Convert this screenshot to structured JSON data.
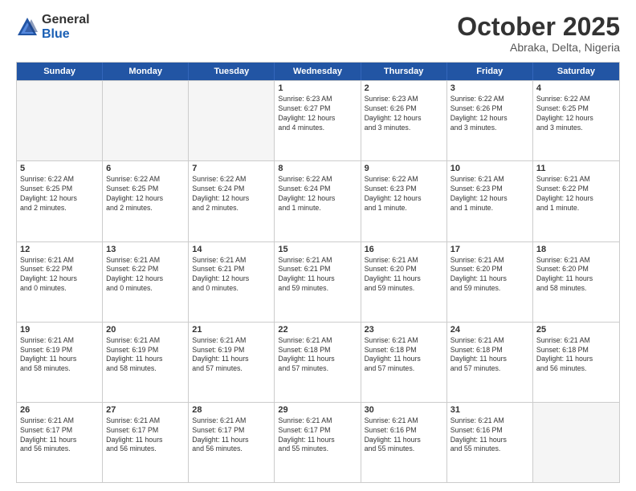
{
  "logo": {
    "general": "General",
    "blue": "Blue"
  },
  "title": "October 2025",
  "location": "Abraka, Delta, Nigeria",
  "days_of_week": [
    "Sunday",
    "Monday",
    "Tuesday",
    "Wednesday",
    "Thursday",
    "Friday",
    "Saturday"
  ],
  "weeks": [
    [
      {
        "day": "",
        "info": ""
      },
      {
        "day": "",
        "info": ""
      },
      {
        "day": "",
        "info": ""
      },
      {
        "day": "1",
        "info": "Sunrise: 6:23 AM\nSunset: 6:27 PM\nDaylight: 12 hours\nand 4 minutes."
      },
      {
        "day": "2",
        "info": "Sunrise: 6:23 AM\nSunset: 6:26 PM\nDaylight: 12 hours\nand 3 minutes."
      },
      {
        "day": "3",
        "info": "Sunrise: 6:22 AM\nSunset: 6:26 PM\nDaylight: 12 hours\nand 3 minutes."
      },
      {
        "day": "4",
        "info": "Sunrise: 6:22 AM\nSunset: 6:25 PM\nDaylight: 12 hours\nand 3 minutes."
      }
    ],
    [
      {
        "day": "5",
        "info": "Sunrise: 6:22 AM\nSunset: 6:25 PM\nDaylight: 12 hours\nand 2 minutes."
      },
      {
        "day": "6",
        "info": "Sunrise: 6:22 AM\nSunset: 6:25 PM\nDaylight: 12 hours\nand 2 minutes."
      },
      {
        "day": "7",
        "info": "Sunrise: 6:22 AM\nSunset: 6:24 PM\nDaylight: 12 hours\nand 2 minutes."
      },
      {
        "day": "8",
        "info": "Sunrise: 6:22 AM\nSunset: 6:24 PM\nDaylight: 12 hours\nand 1 minute."
      },
      {
        "day": "9",
        "info": "Sunrise: 6:22 AM\nSunset: 6:23 PM\nDaylight: 12 hours\nand 1 minute."
      },
      {
        "day": "10",
        "info": "Sunrise: 6:21 AM\nSunset: 6:23 PM\nDaylight: 12 hours\nand 1 minute."
      },
      {
        "day": "11",
        "info": "Sunrise: 6:21 AM\nSunset: 6:22 PM\nDaylight: 12 hours\nand 1 minute."
      }
    ],
    [
      {
        "day": "12",
        "info": "Sunrise: 6:21 AM\nSunset: 6:22 PM\nDaylight: 12 hours\nand 0 minutes."
      },
      {
        "day": "13",
        "info": "Sunrise: 6:21 AM\nSunset: 6:22 PM\nDaylight: 12 hours\nand 0 minutes."
      },
      {
        "day": "14",
        "info": "Sunrise: 6:21 AM\nSunset: 6:21 PM\nDaylight: 12 hours\nand 0 minutes."
      },
      {
        "day": "15",
        "info": "Sunrise: 6:21 AM\nSunset: 6:21 PM\nDaylight: 11 hours\nand 59 minutes."
      },
      {
        "day": "16",
        "info": "Sunrise: 6:21 AM\nSunset: 6:20 PM\nDaylight: 11 hours\nand 59 minutes."
      },
      {
        "day": "17",
        "info": "Sunrise: 6:21 AM\nSunset: 6:20 PM\nDaylight: 11 hours\nand 59 minutes."
      },
      {
        "day": "18",
        "info": "Sunrise: 6:21 AM\nSunset: 6:20 PM\nDaylight: 11 hours\nand 58 minutes."
      }
    ],
    [
      {
        "day": "19",
        "info": "Sunrise: 6:21 AM\nSunset: 6:19 PM\nDaylight: 11 hours\nand 58 minutes."
      },
      {
        "day": "20",
        "info": "Sunrise: 6:21 AM\nSunset: 6:19 PM\nDaylight: 11 hours\nand 58 minutes."
      },
      {
        "day": "21",
        "info": "Sunrise: 6:21 AM\nSunset: 6:19 PM\nDaylight: 11 hours\nand 57 minutes."
      },
      {
        "day": "22",
        "info": "Sunrise: 6:21 AM\nSunset: 6:18 PM\nDaylight: 11 hours\nand 57 minutes."
      },
      {
        "day": "23",
        "info": "Sunrise: 6:21 AM\nSunset: 6:18 PM\nDaylight: 11 hours\nand 57 minutes."
      },
      {
        "day": "24",
        "info": "Sunrise: 6:21 AM\nSunset: 6:18 PM\nDaylight: 11 hours\nand 57 minutes."
      },
      {
        "day": "25",
        "info": "Sunrise: 6:21 AM\nSunset: 6:18 PM\nDaylight: 11 hours\nand 56 minutes."
      }
    ],
    [
      {
        "day": "26",
        "info": "Sunrise: 6:21 AM\nSunset: 6:17 PM\nDaylight: 11 hours\nand 56 minutes."
      },
      {
        "day": "27",
        "info": "Sunrise: 6:21 AM\nSunset: 6:17 PM\nDaylight: 11 hours\nand 56 minutes."
      },
      {
        "day": "28",
        "info": "Sunrise: 6:21 AM\nSunset: 6:17 PM\nDaylight: 11 hours\nand 56 minutes."
      },
      {
        "day": "29",
        "info": "Sunrise: 6:21 AM\nSunset: 6:17 PM\nDaylight: 11 hours\nand 55 minutes."
      },
      {
        "day": "30",
        "info": "Sunrise: 6:21 AM\nSunset: 6:16 PM\nDaylight: 11 hours\nand 55 minutes."
      },
      {
        "day": "31",
        "info": "Sunrise: 6:21 AM\nSunset: 6:16 PM\nDaylight: 11 hours\nand 55 minutes."
      },
      {
        "day": "",
        "info": ""
      }
    ]
  ]
}
